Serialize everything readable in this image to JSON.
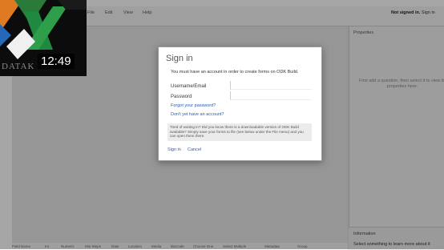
{
  "menu": {
    "items": [
      "File",
      "Edit",
      "View",
      "Help"
    ]
  },
  "status": {
    "prefix": "Not signed in.",
    "link": "Sign in"
  },
  "props": {
    "title": "Properties",
    "message": "First add a question, then select it to view its properties here."
  },
  "info": {
    "title": "Information",
    "message": "Select something to learn more about it"
  },
  "toolbox": [
    "Field Name",
    "Int",
    "Numeric",
    "Min Steps",
    "Date",
    "Location",
    "Media",
    "Barcode",
    "Choose One",
    "Select Multiple",
    "Metadata",
    "Group"
  ],
  "dialog": {
    "title": "Sign in",
    "description": "You must have an account in order to create forms on ODK Build.",
    "username_label": "Username/Email",
    "password_label": "Password",
    "forgot": "Forgot your password?",
    "no_account": "Don't yet have an account?",
    "tip": "Tired of waiting in? Did you know there is a downloadable version of ODK Build available? Simply save your forms to file (see below under the File menu) and you can open them there.",
    "signin_button": "Sign in",
    "cancel_button": "Cancel"
  },
  "video": {
    "timestamp": "12:49",
    "logo_text": "DATAK"
  },
  "colors": {
    "link": "#2a5db0",
    "overlay": "rgba(0,0,0,0.35)"
  }
}
